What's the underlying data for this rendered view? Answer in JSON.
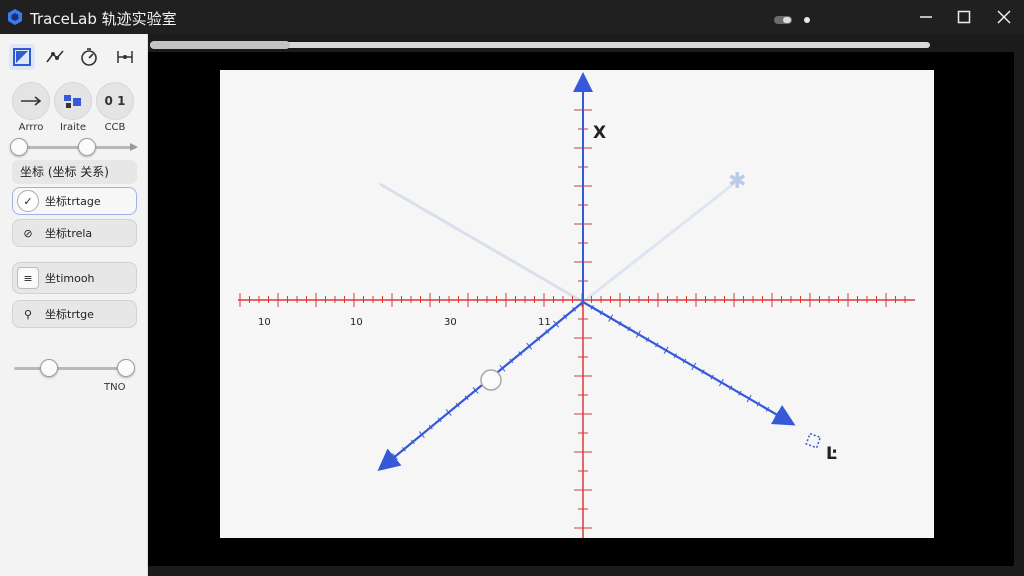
{
  "window": {
    "title": "TraceLab 轨迹实验室",
    "controls": [
      "minimize",
      "maximize",
      "close"
    ]
  },
  "toolbar": {
    "tools": [
      {
        "icon": "select-panel-icon",
        "active": true
      },
      {
        "icon": "trace-path-icon"
      },
      {
        "icon": "timer-icon"
      },
      {
        "icon": "network-icon"
      }
    ]
  },
  "round_buttons": [
    {
      "label": "Arrro",
      "icon": "arrow-icon"
    },
    {
      "label": "Iraite",
      "icon": "blocks-icon"
    },
    {
      "label": "CCB",
      "icon": "counter-icon",
      "glyph": "0 1"
    }
  ],
  "slider_top": {
    "value": 0.6
  },
  "coord_section": {
    "title": "坐标 (坐标 关系)",
    "items": [
      {
        "label": "坐标trtage",
        "icon": "check-icon",
        "selected": true
      },
      {
        "label": "坐标trela",
        "icon": "target-icon"
      },
      {
        "label": "坐timooh",
        "icon": "list-icon"
      },
      {
        "label": "坐标trtge",
        "icon": "search-icon"
      }
    ]
  },
  "slider_bottom": {
    "value": 0.3,
    "label": "TNO"
  },
  "plot": {
    "axis_x_label": "X",
    "axis_corner_label": "Ŀ",
    "tick_labels": [
      "10",
      "10",
      "30",
      "11"
    ],
    "colors": {
      "red_axis": "#d63b3b",
      "blue_axis": "#3559d8",
      "faint": "#bfd1ec"
    }
  }
}
